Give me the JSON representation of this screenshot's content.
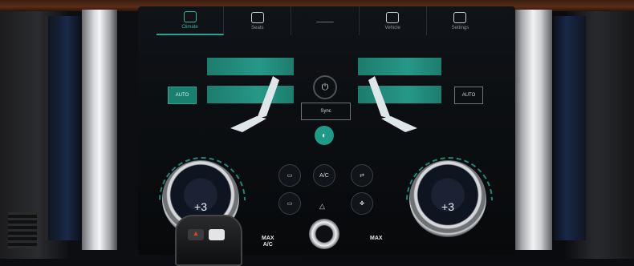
{
  "topbar": {
    "tabs": [
      {
        "label": "Climate",
        "icon": "climate-icon",
        "active": true
      },
      {
        "label": "Seats",
        "icon": "seat-icon",
        "active": false
      },
      {
        "label": "",
        "icon": "divider-icon",
        "active": false
      },
      {
        "label": "Vehicle",
        "icon": "car-icon",
        "active": false
      },
      {
        "label": "Settings",
        "icon": "gear-icon",
        "active": false
      }
    ]
  },
  "climate": {
    "auto_left": "AUTO",
    "auto_right": "AUTO",
    "sync_label": "Sync",
    "power_glyph": "⏻",
    "fan_glyph": "◐"
  },
  "controls": {
    "rear_defrost": "▭",
    "ac_label": "A/C",
    "recirc": "⇄",
    "front_defrost": "▭",
    "fan_speed": "✤",
    "center": "△",
    "max_ac_label": "MAX\nA/C",
    "max_defrost_label": "MAX"
  },
  "dials": {
    "left_temp": "+3",
    "right_temp": "+3"
  },
  "colors": {
    "accent": "#2aa18f",
    "auto_active_bg": "#19806f"
  }
}
